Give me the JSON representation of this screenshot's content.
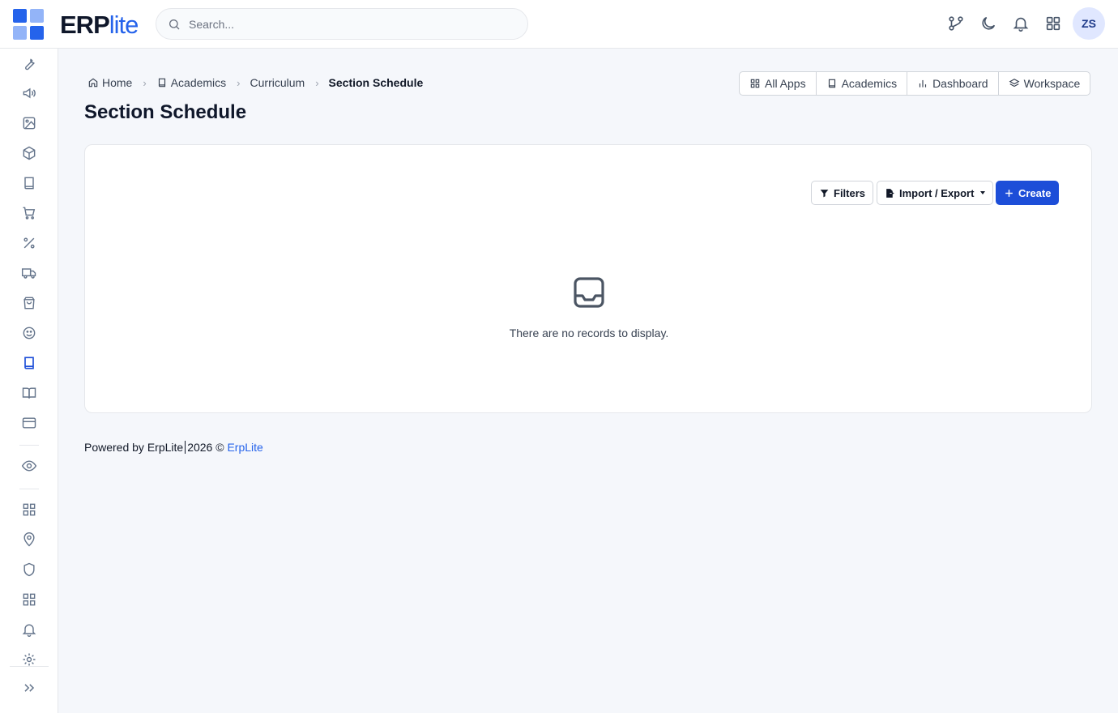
{
  "brand": {
    "name_part1": "ERP",
    "name_part2": "lite",
    "primary_color": "#2563eb"
  },
  "search": {
    "placeholder": "Search..."
  },
  "topbar": {
    "icons": [
      "git-branch-icon",
      "moon-icon",
      "bell-icon",
      "apps-grid-icon"
    ],
    "avatar_initials": "ZS"
  },
  "sidebar": {
    "items": [
      "wrench-icon",
      "megaphone-icon",
      "image-icon",
      "cube-icon",
      "book-icon",
      "cart-icon",
      "percent-icon",
      "truck-icon",
      "shopping-bag-icon",
      "smile-icon",
      "book-active-icon",
      "book-open-icon",
      "credit-card-icon",
      "eye-icon",
      "grid-icon",
      "map-pin-icon",
      "shield-icon",
      "grid-icon",
      "bell-icon",
      "settings-icon"
    ],
    "active_item": "book-active-icon",
    "expand_icon": "chevrons-right-icon"
  },
  "breadcrumb": {
    "items": [
      {
        "label": "Home",
        "icon": "home-icon"
      },
      {
        "label": "Academics",
        "icon": "book-icon"
      },
      {
        "label": "Curriculum"
      },
      {
        "label": "Section Schedule"
      }
    ],
    "separator": "›"
  },
  "quicklinks": [
    {
      "label": "All Apps",
      "icon": "grid-icon"
    },
    {
      "label": "Academics",
      "icon": "book-icon"
    },
    {
      "label": "Dashboard",
      "icon": "bar-chart-icon"
    },
    {
      "label": "Workspace",
      "icon": "layers-icon"
    }
  ],
  "page": {
    "title": "Section Schedule"
  },
  "toolbar": {
    "filters_label": "Filters",
    "import_export_label": "Import / Export",
    "create_label": "Create"
  },
  "empty_state": {
    "message": "There are no records to display."
  },
  "footer": {
    "powered_by": "Powered by ErpLite",
    "year": "2026 ©",
    "link_label": "ErpLite"
  }
}
